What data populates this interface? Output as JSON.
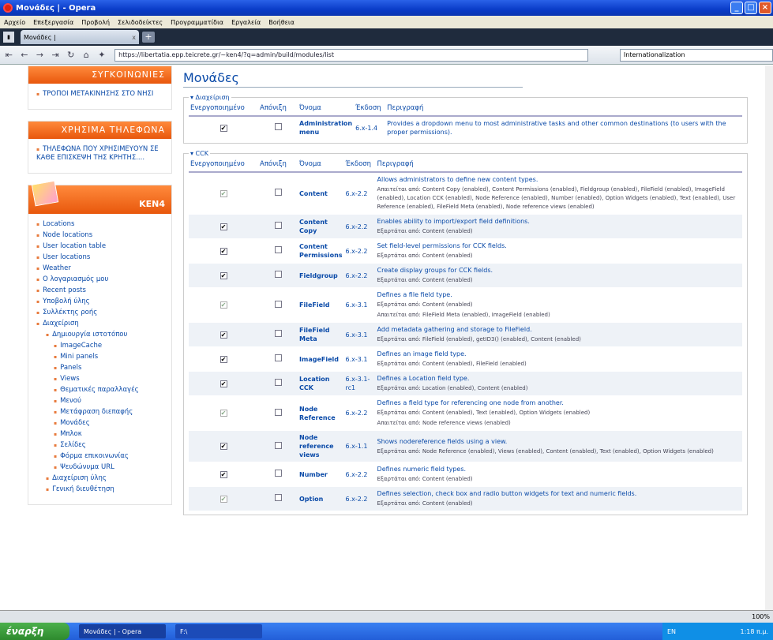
{
  "window": {
    "title": "Μονάδες | - Opera"
  },
  "menu": [
    "Αρχείο",
    "Επεξεργασία",
    "Προβολή",
    "Σελιδοδείκτες",
    "Προγραμματίδια",
    "Εργαλεία",
    "Βοήθεια"
  ],
  "tab": {
    "label": "Μονάδες |",
    "close": "x",
    "new": "+"
  },
  "address": {
    "url": "https://libertatia.epp.teicrete.gr/~ken4/?q=admin/build/modules/list",
    "search": "Internationalization"
  },
  "sidebar": {
    "transport_title": "ΣΥΓΚΟΙΝΩΝΙΕΣ",
    "transport_items": [
      "ΤΡΟΠΟΙ ΜΕΤΑΚΙΝΗΣΗΣ ΣΤΟ ΝΗΣΙ"
    ],
    "phones_title": "ΧΡΗΣΙΜΑ ΤΗΛΕΦΩΝΑ",
    "phones_items": [
      "ΤΗΛΕΦΩΝΑ ΠΟΥ ΧΡΗΣΙΜΕΥΟΥΝ ΣΕ ΚΑΘΕ ΕΠΙΣΚΕΨΗ ΤΗΣ ΚΡΗΤΗΣ...."
    ],
    "ken_title": "KEN4",
    "ken_items": [
      "Locations",
      "Node locations",
      "User location table",
      "User locations",
      "Weather",
      "Ο λογαριασμός μου",
      "Recent posts",
      "Υποβολή ύλης",
      "Συλλέκτης ροής",
      "Διαχείριση"
    ],
    "admin_sub": [
      "Δημιουργία ιστοτόπου"
    ],
    "admin_sub2": [
      "ImageCache",
      "Mini panels",
      "Panels",
      "Views",
      "Θεματικές παραλλαγές",
      "Μενού",
      "Μετάφραση διεπαφής",
      "Μονάδες",
      "Μπλοκ",
      "Σελίδες",
      "Φόρμα επικοινωνίας",
      "Ψευδώνυμα URL"
    ],
    "admin_sub_more": [
      "Διαχείριση ύλης",
      "Γενική διευθέτηση"
    ]
  },
  "main": {
    "title": "Μονάδες",
    "headers": {
      "enabled": "Ενεργοποιημένο",
      "throttle": "Απόνιξη",
      "name": "Όνομα",
      "version": "Έκδοση",
      "desc": "Περιγραφή"
    },
    "groups": [
      {
        "legend": "▾ Διαχείριση",
        "modules": [
          {
            "name": "Administration menu",
            "version": "6.x-1.4",
            "enabled": true,
            "disabled_box": false,
            "desc": "Provides a dropdown menu to most administrative tasks and other common destinations (to users with the proper permissions).",
            "requires": "",
            "required_by": ""
          }
        ]
      },
      {
        "legend": "▾ CCK",
        "modules": [
          {
            "name": "Content",
            "version": "6.x-2.2",
            "enabled": true,
            "disabled_box": true,
            "desc": "Allows administrators to define new content types.",
            "requires": "",
            "required_by": "Απαιτείται από: Content Copy (enabled), Content Permissions (enabled), Fieldgroup (enabled), FileField (enabled), ImageField (enabled), Location CCK (enabled), Node Reference (enabled), Number (enabled), Option Widgets (enabled), Text (enabled), User Reference (enabled), FileField Meta (enabled), Node reference views (enabled)"
          },
          {
            "name": "Content Copy",
            "version": "6.x-2.2",
            "enabled": true,
            "disabled_box": false,
            "desc": "Enables ability to import/export field definitions.",
            "requires": "Εξαρτάται από: Content (enabled)",
            "required_by": ""
          },
          {
            "name": "Content Permissions",
            "version": "6.x-2.2",
            "enabled": true,
            "disabled_box": false,
            "desc": "Set field-level permissions for CCK fields.",
            "requires": "Εξαρτάται από: Content (enabled)",
            "required_by": ""
          },
          {
            "name": "Fieldgroup",
            "version": "6.x-2.2",
            "enabled": true,
            "disabled_box": false,
            "desc": "Create display groups for CCK fields.",
            "requires": "Εξαρτάται από: Content (enabled)",
            "required_by": ""
          },
          {
            "name": "FileField",
            "version": "6.x-3.1",
            "enabled": true,
            "disabled_box": true,
            "desc": "Defines a file field type.",
            "requires": "Εξαρτάται από: Content (enabled)",
            "required_by": "Απαιτείται από: FileField Meta (enabled), ImageField (enabled)"
          },
          {
            "name": "FileField Meta",
            "version": "6.x-3.1",
            "enabled": true,
            "disabled_box": false,
            "desc": "Add metadata gathering and storage to FileField.",
            "requires": "Εξαρτάται από: FileField (enabled), getID3() (enabled), Content (enabled)",
            "required_by": ""
          },
          {
            "name": "ImageField",
            "version": "6.x-3.1",
            "enabled": true,
            "disabled_box": false,
            "desc": "Defines an image field type.",
            "requires": "Εξαρτάται από: Content (enabled), FileField (enabled)",
            "required_by": ""
          },
          {
            "name": "Location CCK",
            "version": "6.x-3.1-rc1",
            "enabled": true,
            "disabled_box": false,
            "desc": "Defines a Location field type.",
            "requires": "Εξαρτάται από: Location (enabled), Content (enabled)",
            "required_by": ""
          },
          {
            "name": "Node Reference",
            "version": "6.x-2.2",
            "enabled": true,
            "disabled_box": true,
            "desc": "Defines a field type for referencing one node from another.",
            "requires": "Εξαρτάται από: Content (enabled), Text (enabled), Option Widgets (enabled)",
            "required_by": "Απαιτείται από: Node reference views (enabled)"
          },
          {
            "name": "Node reference views",
            "version": "6.x-1.1",
            "enabled": true,
            "disabled_box": false,
            "desc": "Shows nodereference fields using a view.",
            "requires": "Εξαρτάται από: Node Reference (enabled), Views (enabled), Content (enabled), Text (enabled), Option Widgets (enabled)",
            "required_by": ""
          },
          {
            "name": "Number",
            "version": "6.x-2.2",
            "enabled": true,
            "disabled_box": false,
            "desc": "Defines numeric field types.",
            "requires": "Εξαρτάται από: Content (enabled)",
            "required_by": ""
          },
          {
            "name": "Option",
            "version": "6.x-2.2",
            "enabled": true,
            "disabled_box": true,
            "desc": "Defines selection, check box and radio button widgets for text and numeric fields.",
            "requires": "Εξαρτάται από: Content (enabled)",
            "required_by": ""
          }
        ]
      }
    ]
  },
  "status": {
    "zoom": "100%"
  },
  "taskbar": {
    "start": "έναρξη",
    "tasks": [
      "Μονάδες | - Opera",
      "F:\\"
    ],
    "lang": "EN",
    "time": "1:18 π.μ."
  }
}
